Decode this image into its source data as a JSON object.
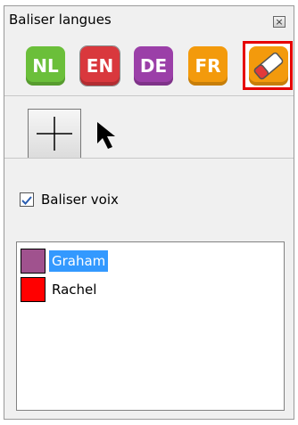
{
  "window": {
    "title": "Baliser langues",
    "close_glyph": "×"
  },
  "toolbar": {
    "languages": [
      {
        "label": "NL",
        "color": "#6bbf3a"
      },
      {
        "label": "EN",
        "color": "#d9383d"
      },
      {
        "label": "DE",
        "color": "#9b3fa8"
      },
      {
        "label": "FR",
        "color": "#f39a0c"
      }
    ],
    "eraser": {
      "icon": "eraser-icon",
      "color": "#f39a0c",
      "selected_border": "#e60000"
    },
    "add_icon": "plus-icon",
    "pointer_icon": "cursor-arrow-icon"
  },
  "options": {
    "tag_voices_label": "Baliser voix",
    "tag_voices_checked": true
  },
  "speakers": [
    {
      "name": "Graham",
      "color": "#a0528e",
      "selected": true
    },
    {
      "name": "Rachel",
      "color": "#ff0000",
      "selected": false
    }
  ]
}
